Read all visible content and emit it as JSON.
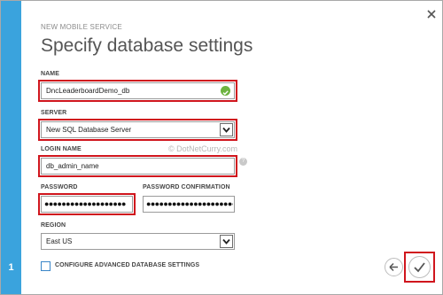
{
  "dialog": {
    "wizard_label": "NEW MOBILE SERVICE",
    "title": "Specify database settings",
    "step_number": "1"
  },
  "form": {
    "name": {
      "label": "NAME",
      "value": "DncLeaderboardDemo_db"
    },
    "server": {
      "label": "SERVER",
      "selected": "New SQL Database Server"
    },
    "login_name": {
      "label": "LOGIN NAME",
      "value": "db_admin_name"
    },
    "password": {
      "label": "PASSWORD",
      "masked": "●●●●●●●●●●●●●●●●●●●"
    },
    "password_confirmation": {
      "label": "PASSWORD CONFIRMATION",
      "masked": "●●●●●●●●●●●●●●●●●●●●●●●"
    },
    "region": {
      "label": "REGION",
      "selected": "East US"
    },
    "advanced": {
      "label": "CONFIGURE ADVANCED DATABASE SETTINGS",
      "checked": false
    }
  },
  "watermark": "© DotNetCurry.com",
  "icons": {
    "close": "close-icon",
    "valid": "check-circle-icon",
    "dropdown": "chevron-down-icon",
    "help": "question-icon",
    "back": "arrow-left-icon",
    "finish": "checkmark-icon"
  },
  "colors": {
    "accent": "#3aa3dd",
    "highlight": "#d0151d",
    "valid": "#6db33f"
  }
}
